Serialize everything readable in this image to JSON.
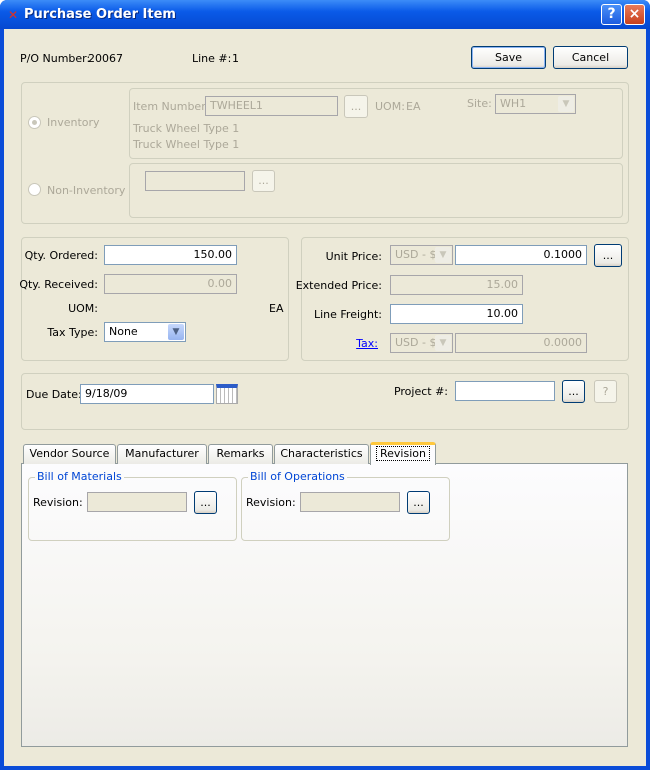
{
  "window": {
    "title": "Purchase Order Item",
    "help_icon": "?",
    "close_icon": "×"
  },
  "header": {
    "po_label": "P/O Number:",
    "po_value": "20067",
    "line_label": "Line #:",
    "line_value": "1",
    "save": "Save",
    "cancel": "Cancel"
  },
  "item": {
    "inventory_label": "Inventory",
    "item_number_label": "Item Number:",
    "item_number": "TWHEEL1",
    "lookup": "...",
    "uom_label": "UOM:",
    "uom": "EA",
    "site_label": "Site:",
    "site": "WH1",
    "desc1": "Truck Wheel Type 1",
    "desc2": "Truck Wheel Type 1",
    "non_inventory_label": "Non-Inventory",
    "non_inventory_value": ""
  },
  "qty": {
    "ordered_label": "Qty. Ordered:",
    "ordered": "150.00",
    "received_label": "Qty. Received:",
    "received": "0.00",
    "uom_label": "UOM:",
    "uom": "EA",
    "tax_type_label": "Tax Type:",
    "tax_type": "None"
  },
  "price": {
    "unit_price_label": "Unit Price:",
    "currency": "USD - $",
    "unit_price": "0.1000",
    "extended_label": "Extended Price:",
    "extended": "15.00",
    "freight_label": "Line Freight:",
    "freight": "10.00",
    "tax_label": "Tax:",
    "tax_currency": "USD - $",
    "tax": "0.0000"
  },
  "misc": {
    "due_date_label": "Due Date:",
    "due_date": "9/18/09",
    "project_label": "Project #:",
    "project": "",
    "help": "?"
  },
  "tabs": [
    "Vendor Source",
    "Manufacturer",
    "Remarks",
    "Characteristics",
    "Revision"
  ],
  "revision": {
    "bom_title": "Bill of Materials",
    "boo_title": "Bill of Operations",
    "revision_label": "Revision:",
    "bom_revision": "",
    "boo_revision": ""
  }
}
